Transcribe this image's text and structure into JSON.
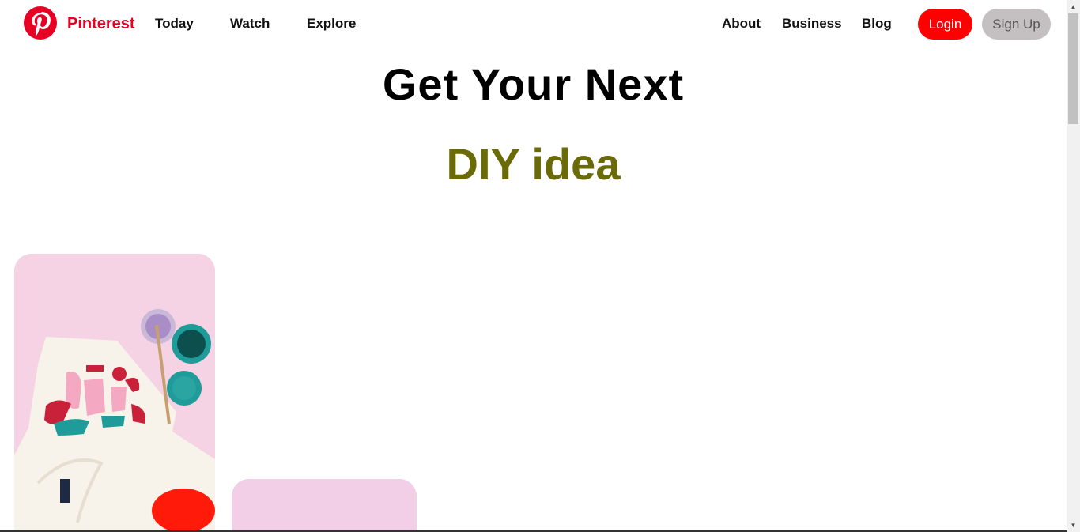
{
  "header": {
    "brand": "Pinterest",
    "logo_icon": "pinterest-logo-icon",
    "nav_left": [
      "Today",
      "Watch",
      "Explore"
    ],
    "nav_right": [
      "About",
      "Business",
      "Blog"
    ],
    "login_label": "Login",
    "signup_label": "Sign Up"
  },
  "hero": {
    "title": "Get Your Next",
    "subtitle": "DIY idea"
  },
  "pins": [
    {
      "subject": "painted t-shirt with paint jars and brush"
    },
    {
      "subject": "pink background pin"
    }
  ],
  "colors": {
    "brand": "#e60023",
    "login_bg": "#ff0000",
    "signup_bg": "#c4bfc0",
    "subtitle": "#6a6a06"
  }
}
